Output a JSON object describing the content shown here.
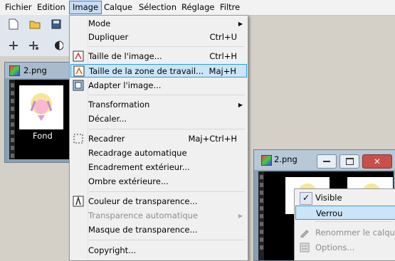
{
  "menubar": {
    "items": [
      "Fichier",
      "Edition",
      "Image",
      "Calque",
      "Sélection",
      "Réglage",
      "Filtre"
    ],
    "active_index": 2
  },
  "document": {
    "filename": "2.png",
    "layer_name": "Fond"
  },
  "image_menu": {
    "items": [
      {
        "label": "Mode",
        "shortcut": "",
        "submenu": true,
        "icon": ""
      },
      {
        "label": "Dupliquer",
        "shortcut": "Ctrl+U",
        "submenu": false,
        "icon": ""
      },
      {
        "label": "Taille de l'image...",
        "shortcut": "Ctrl+H",
        "submenu": false,
        "icon": "resize-image-icon"
      },
      {
        "label": "Taille de la zone de travail...",
        "shortcut": "Maj+H",
        "submenu": false,
        "icon": "canvas-size-icon",
        "highlighted": true
      },
      {
        "label": "Adapter l'image...",
        "shortcut": "",
        "submenu": false,
        "icon": "fit-image-icon"
      },
      {
        "label": "Transformation",
        "shortcut": "",
        "submenu": true,
        "icon": ""
      },
      {
        "label": "Décaler...",
        "shortcut": "",
        "submenu": false,
        "icon": ""
      },
      {
        "label": "Recadrer",
        "shortcut": "Maj+Ctrl+H",
        "submenu": false,
        "icon": "crop-icon"
      },
      {
        "label": "Recadrage automatique",
        "shortcut": "",
        "submenu": false,
        "icon": ""
      },
      {
        "label": "Encadrement extérieur...",
        "shortcut": "",
        "submenu": false,
        "icon": ""
      },
      {
        "label": "Ombre extérieure...",
        "shortcut": "",
        "submenu": false,
        "icon": ""
      },
      {
        "label": "Couleur de transparence...",
        "shortcut": "",
        "submenu": false,
        "icon": "transparency-color-icon"
      },
      {
        "label": "Transparence automatique",
        "shortcut": "",
        "submenu": true,
        "icon": "",
        "disabled": true
      },
      {
        "label": "Masque de transparence...",
        "shortcut": "",
        "submenu": false,
        "icon": ""
      },
      {
        "label": "Copyright...",
        "shortcut": "",
        "submenu": false,
        "icon": ""
      }
    ]
  },
  "context_menu": {
    "items": [
      {
        "label": "Visible",
        "checked": true
      },
      {
        "label": "Verrou",
        "highlighted": true
      },
      {
        "label": "Renommer le calque...",
        "disabled": true
      },
      {
        "label": "Options...",
        "disabled": true
      }
    ]
  },
  "colors": {
    "menu_highlight": "#cce4f7",
    "menu_highlight_border": "#26a0da",
    "menubar_active": "#c6dcf4"
  }
}
